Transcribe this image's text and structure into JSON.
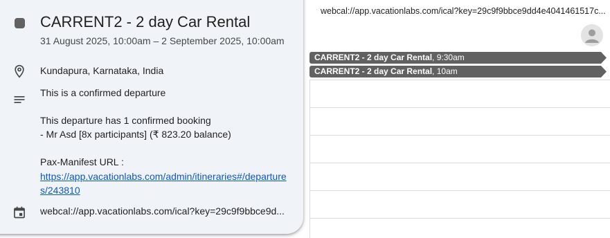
{
  "calendar": {
    "top_url": "webcal://app.vacationlabs.com/ical?key=29c9f9bbce9dd4e4041461517c...",
    "avatar_icon": "account-circle-icon",
    "events": [
      {
        "title": "CARRENT2 - 2 day Car Rental",
        "time": ", 9:30am"
      },
      {
        "title": "CARRENT2 - 2 day Car Rental",
        "time": ", 10am"
      }
    ],
    "chip_color": "#616161"
  },
  "popup": {
    "color_swatch": "#616161",
    "title": "CARRENT2 - 2 day Car Rental",
    "datetime": "31 August 2025, 10:00am – 2 September 2025, 10:00am",
    "location_icon": "location-pin-icon",
    "location": "Kundapura, Karnataka, India",
    "description_icon": "notes-icon",
    "description": {
      "line1": "This is a confirmed departure",
      "line2": "This departure has 1 confirmed booking",
      "line3": "- Mr Asd [8x participants] (₹ 823.20 balance)",
      "line4": "Pax-Manifest URL :",
      "link": "https://app.vacationlabs.com/admin/itineraries#/departures/243810"
    },
    "calendar_icon": "calendar-icon",
    "subscription": "webcal://app.vacationlabs.com/ical?key=29c9f9bbce9d..."
  }
}
